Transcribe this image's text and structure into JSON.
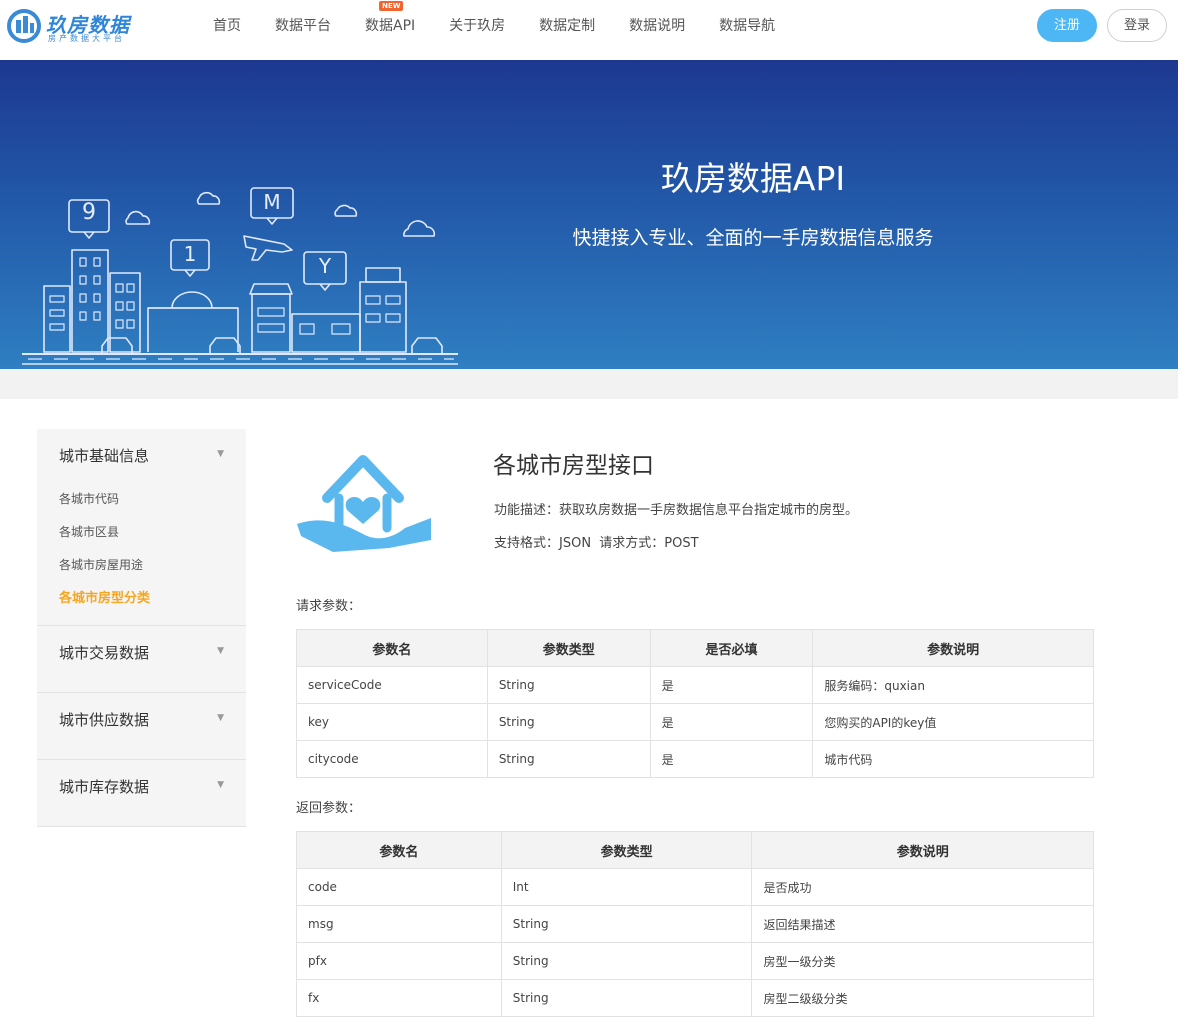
{
  "header": {
    "logo_text": "玖房数据",
    "logo_sub": "房产数据大平台",
    "nav": [
      {
        "label": "首页",
        "badge": ""
      },
      {
        "label": "数据平台",
        "badge": ""
      },
      {
        "label": "数据API",
        "badge": "NEW"
      },
      {
        "label": "关于玖房",
        "badge": ""
      },
      {
        "label": "数据定制",
        "badge": ""
      },
      {
        "label": "数据说明",
        "badge": ""
      },
      {
        "label": "数据导航",
        "badge": ""
      }
    ],
    "register_label": "注册",
    "login_label": "登录"
  },
  "banner": {
    "title": "玖房数据API",
    "subtitle": "快捷接入专业、全面的一手房数据信息服务",
    "sign_labels": [
      "9",
      "1",
      "M",
      "Y"
    ]
  },
  "sidebar": {
    "groups": [
      {
        "label": "城市基础信息",
        "items": [
          "各城市代码",
          "各城市区县",
          "各城市房屋用途",
          "各城市房型分类"
        ]
      },
      {
        "label": "城市交易数据",
        "items": []
      },
      {
        "label": "城市供应数据",
        "items": []
      },
      {
        "label": "城市库存数据",
        "items": []
      }
    ],
    "active_item": "各城市房型分类"
  },
  "api": {
    "title": "各城市房型接口",
    "description": "功能描述：获取玖房数据一手房数据信息平台指定城市的房型。",
    "format": "支持格式：JSON  请求方式：POST"
  },
  "request": {
    "label": "请求参数：",
    "headers": [
      "参数名",
      "参数类型",
      "是否必填",
      "参数说明"
    ],
    "rows": [
      [
        "serviceCode",
        "String",
        "是",
        "服务编码：quxian"
      ],
      [
        "key",
        "String",
        "是",
        "您购买的API的key值"
      ],
      [
        "citycode",
        "String",
        "是",
        "城市代码"
      ]
    ]
  },
  "response": {
    "label": "返回参数：",
    "headers": [
      "参数名",
      "参数类型",
      "参数说明"
    ],
    "rows": [
      [
        "code",
        "Int",
        "是否成功"
      ],
      [
        "msg",
        "String",
        "返回结果描述"
      ],
      [
        "pfx",
        "String",
        "房型一级分类"
      ],
      [
        "fx",
        "String",
        "房型二级级分类"
      ]
    ]
  },
  "colors": {
    "accent": "#4db6f5",
    "active": "#f5a623",
    "banner_top": "#1d3890",
    "banner_bottom": "#2f7fc2"
  }
}
